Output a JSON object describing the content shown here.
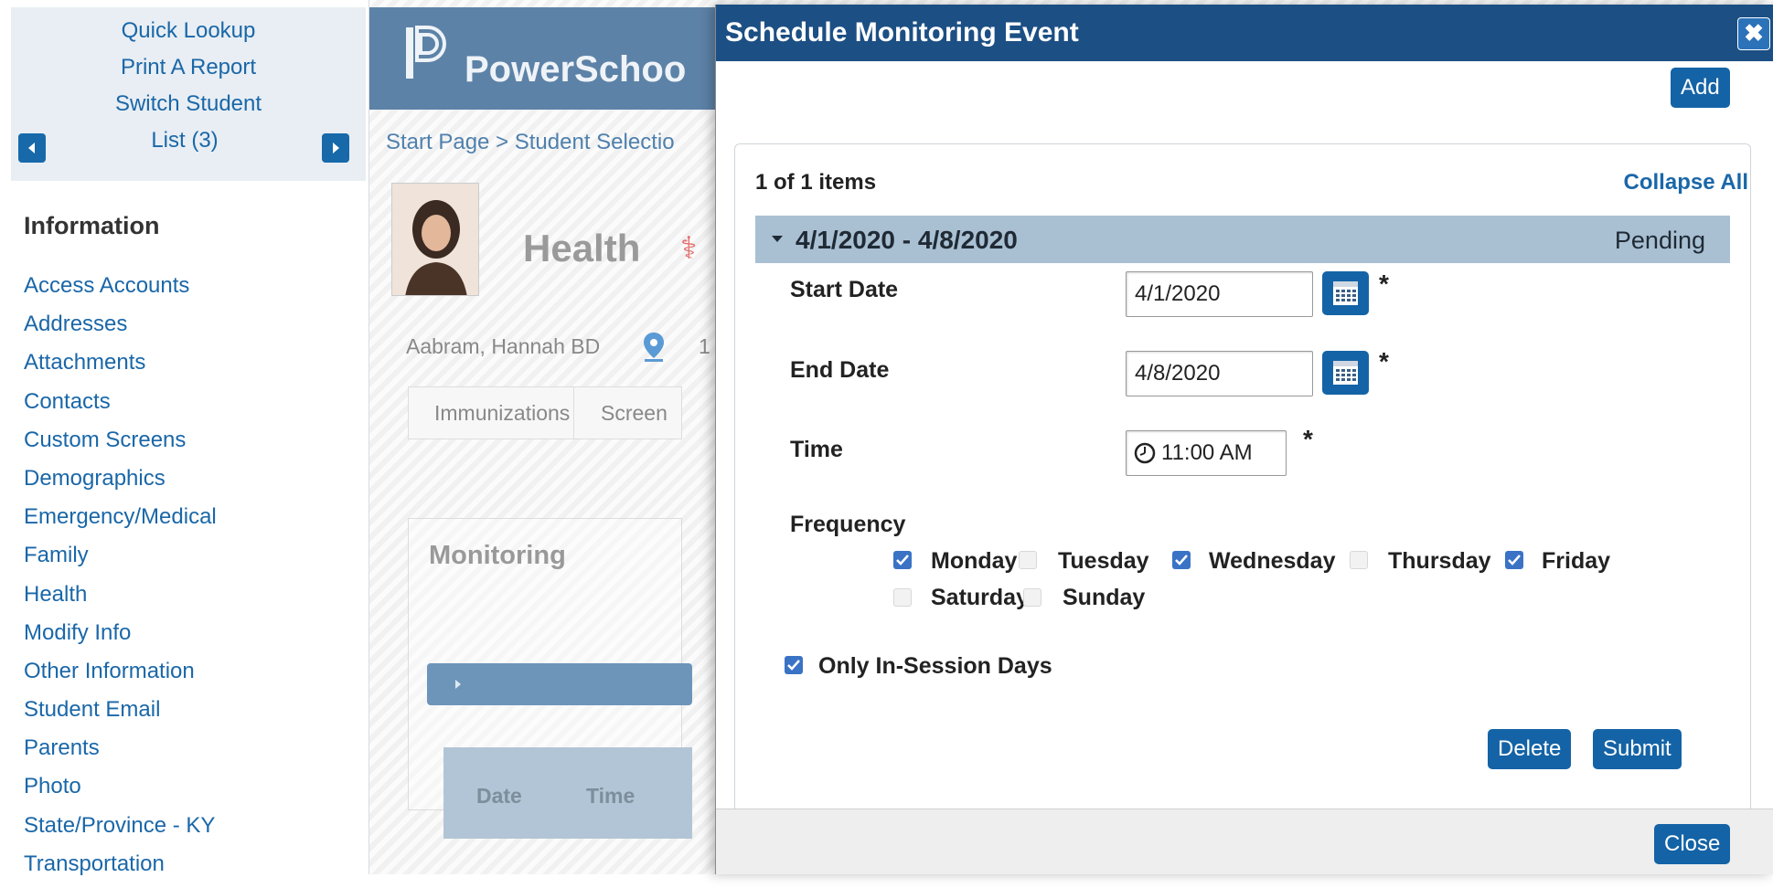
{
  "sidebar": {
    "quick_lookup": "Quick Lookup",
    "print_report": "Print A Report",
    "switch_student": "Switch Student",
    "list_label": "List (3)",
    "section_title": "Information",
    "links": [
      "Access Accounts",
      "Addresses",
      "Attachments",
      "Contacts",
      "Custom Screens",
      "Demographics",
      "Emergency/Medical",
      "Family",
      "Health",
      "Modify Info",
      "Other Information",
      "Student Email",
      "Parents",
      "Photo",
      "State/Province - KY",
      "Transportation"
    ]
  },
  "page": {
    "brand": "PowerSchoo",
    "breadcrumb": "Start Page > Student Selectio",
    "title": "Health",
    "student_name": "Aabram, Hannah BD",
    "student_extra": "1",
    "tabs": [
      "Immunizations",
      "Screen"
    ],
    "section_title": "Monitoring",
    "table_headers": [
      "Date",
      "Time"
    ]
  },
  "dialog": {
    "title": "Schedule Monitoring Event",
    "close_x": "✖",
    "add_label": "Add",
    "items_count": "1 of 1 items",
    "collapse_all": "Collapse All",
    "record": {
      "range": "4/1/2020 - 4/8/2020",
      "status": "Pending",
      "start_date_label": "Start Date",
      "start_date": "4/1/2020",
      "end_date_label": "End Date",
      "end_date": "4/8/2020",
      "time_label": "Time",
      "time": "11:00 AM",
      "frequency_label": "Frequency",
      "days": [
        {
          "name": "Monday",
          "checked": true
        },
        {
          "name": "Tuesday",
          "checked": false
        },
        {
          "name": "Wednesday",
          "checked": true
        },
        {
          "name": "Thursday",
          "checked": false
        },
        {
          "name": "Friday",
          "checked": true
        },
        {
          "name": "Saturday",
          "checked": false
        },
        {
          "name": "Sunday",
          "checked": false
        }
      ],
      "in_session_label": "Only In-Session Days",
      "in_session_checked": true,
      "required_marker": "*"
    },
    "delete_label": "Delete",
    "submit_label": "Submit",
    "close_label": "Close"
  },
  "colors": {
    "dialog_header": "#1c4f84",
    "button": "#1463a6",
    "link": "#1a67a8",
    "record_header": "#a9c0d3",
    "checkbox_on": "#3a73c5"
  },
  "icons": [
    "chevron-left-icon",
    "chevron-right-icon",
    "powerschool-logo",
    "student-photo",
    "staff-of-asclepius-icon",
    "map-pin-icon",
    "caret-down-icon",
    "calendar-icon",
    "clock-icon",
    "checkmark-icon",
    "close-icon"
  ]
}
